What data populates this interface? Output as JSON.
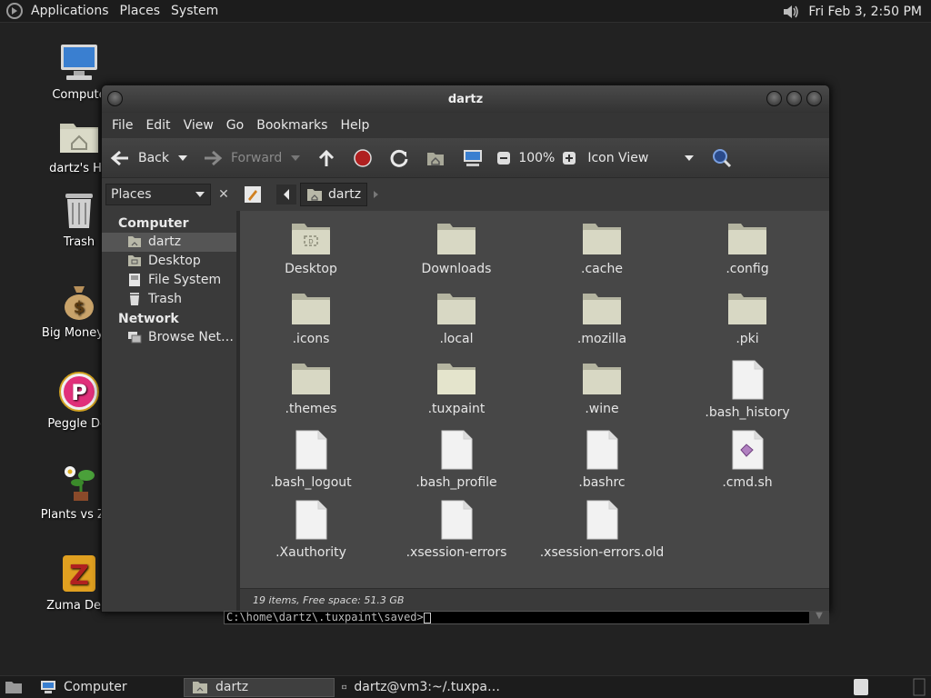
{
  "top_panel": {
    "menus": [
      "Applications",
      "Places",
      "System"
    ],
    "clock": "Fri Feb  3,  2:50 PM"
  },
  "desktop_icons": [
    {
      "label": "Compute",
      "icon": "computer-icon"
    },
    {
      "label": "dartz's Ho",
      "icon": "home-folder-icon"
    },
    {
      "label": "Trash",
      "icon": "trash-icon"
    },
    {
      "label": "Big Money D",
      "icon": "money-bag-icon"
    },
    {
      "label": "Peggle Del",
      "icon": "peggle-icon"
    },
    {
      "label": "Plants vs Zor",
      "icon": "plants-icon"
    },
    {
      "label": "Zuma Delu",
      "icon": "zuma-icon"
    }
  ],
  "window": {
    "title": "dartz",
    "menu": [
      "File",
      "Edit",
      "View",
      "Go",
      "Bookmarks",
      "Help"
    ],
    "toolbar": {
      "back": "Back",
      "forward": "Forward",
      "zoom": "100%",
      "view_mode": "Icon View"
    },
    "location": {
      "pane_selector": "Places",
      "crumb": "dartz"
    },
    "sidebar": {
      "sections": [
        {
          "heading": "Computer",
          "items": [
            {
              "label": "dartz",
              "icon": "home-icon"
            },
            {
              "label": "Desktop",
              "icon": "desktop-icon"
            },
            {
              "label": "File System",
              "icon": "drive-icon"
            },
            {
              "label": "Trash",
              "icon": "trash-icon"
            }
          ]
        },
        {
          "heading": "Network",
          "items": [
            {
              "label": "Browse Net…",
              "icon": "network-icon"
            }
          ]
        }
      ]
    },
    "files": [
      {
        "name": "Desktop",
        "kind": "folder-desktop"
      },
      {
        "name": "Downloads",
        "kind": "folder"
      },
      {
        "name": ".cache",
        "kind": "folder"
      },
      {
        "name": ".config",
        "kind": "folder"
      },
      {
        "name": ".icons",
        "kind": "folder"
      },
      {
        "name": ".local",
        "kind": "folder"
      },
      {
        "name": ".mozilla",
        "kind": "folder"
      },
      {
        "name": ".pki",
        "kind": "folder"
      },
      {
        "name": ".themes",
        "kind": "folder"
      },
      {
        "name": ".tuxpaint",
        "kind": "folder-open"
      },
      {
        "name": ".wine",
        "kind": "folder"
      },
      {
        "name": ".bash_history",
        "kind": "file"
      },
      {
        "name": ".bash_logout",
        "kind": "file"
      },
      {
        "name": ".bash_profile",
        "kind": "file"
      },
      {
        "name": ".bashrc",
        "kind": "file"
      },
      {
        "name": ".cmd.sh",
        "kind": "script"
      },
      {
        "name": ".Xauthority",
        "kind": "file"
      },
      {
        "name": ".xsession-errors",
        "kind": "file"
      },
      {
        "name": ".xsession-errors.old",
        "kind": "file"
      }
    ],
    "status": "19 items, Free space: 51.3 GB"
  },
  "terminal_line": "C:\\home\\dartz\\.tuxpaint\\saved>",
  "taskbar": [
    {
      "label": "Computer",
      "active": false
    },
    {
      "label": "dartz",
      "active": true
    },
    {
      "label": "dartz@vm3:~/.tuxpa…",
      "active": false
    }
  ]
}
